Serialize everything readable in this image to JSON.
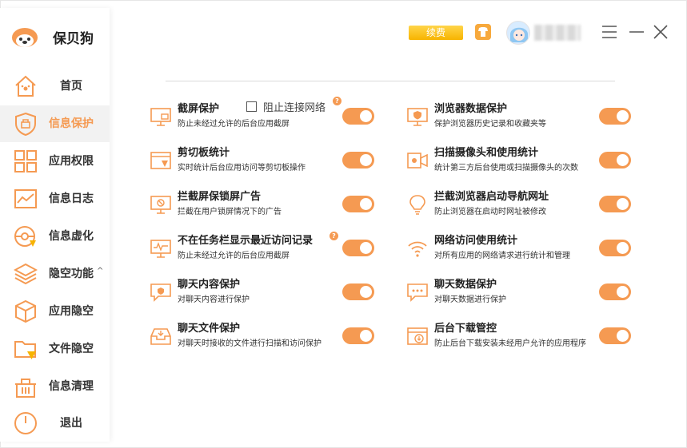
{
  "app": {
    "name": "保贝狗"
  },
  "header": {
    "renew_label": "续费"
  },
  "sidebar": {
    "items": [
      {
        "label": "首页"
      },
      {
        "label": "信息保护"
      },
      {
        "label": "应用权限"
      },
      {
        "label": "信息日志"
      },
      {
        "label": "信息虚化"
      },
      {
        "label": "隐空功能",
        "caret": "^"
      },
      {
        "label": "应用隐空"
      },
      {
        "label": "文件隐空"
      },
      {
        "label": "信息清理"
      },
      {
        "label": "退出"
      }
    ]
  },
  "options": {
    "block_network_label": "阻止连接网络"
  },
  "features": [
    {
      "title": "截屏保护",
      "desc": "防止未经过允许的后台应用截屏",
      "enabled": true
    },
    {
      "title": "浏览器数据保护",
      "desc": "保护浏览器历史记录和收藏夹等",
      "enabled": true
    },
    {
      "title": "剪切板统计",
      "desc": "实时统计后台应用访问等剪切板操作",
      "enabled": true
    },
    {
      "title": "扫描摄像头和使用统计",
      "desc": "统计第三方后台使用或扫描摄像头的次数",
      "enabled": true
    },
    {
      "title": "拦截屏保锁屏广告",
      "desc": "拦截在用户锁屏情况下的广告",
      "enabled": true
    },
    {
      "title": "拦截浏览器启动导航网址",
      "desc": "防止浏览器在启动时网址被修改",
      "enabled": true
    },
    {
      "title": "不在任务栏显示最近访问记录",
      "desc": "防止未经过允许的后台应用截屏",
      "enabled": true
    },
    {
      "title": "网络访问使用统计",
      "desc": "对所有应用的网络请求进行统计和管理",
      "enabled": true
    },
    {
      "title": "聊天内容保护",
      "desc": "对聊天内容进行保护",
      "enabled": true
    },
    {
      "title": "聊天数据保护",
      "desc": "对聊天数据进行保护",
      "enabled": true
    },
    {
      "title": "聊天文件保护",
      "desc": "对聊天时接收的文件进行扫描和访问保护",
      "enabled": true
    },
    {
      "title": "后台下载管控",
      "desc": "防止后台下载安装未经用户允许的应用程序",
      "enabled": true
    }
  ],
  "help_glyph": "?",
  "colors": {
    "accent": "#f59a52",
    "renew_bg": "#f7b400",
    "active_bg": "#f2f2f2"
  }
}
